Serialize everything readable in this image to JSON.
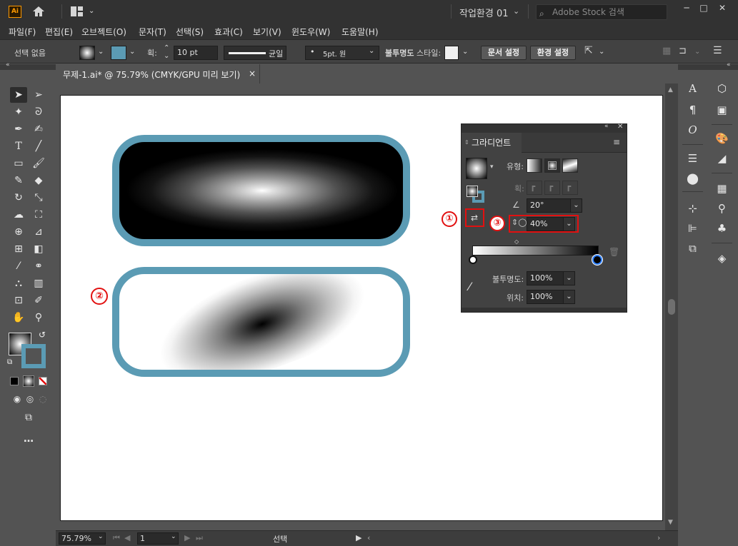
{
  "app": {
    "logo": "Ai",
    "workspace": "작업환경 01",
    "stock_search_placeholder": "Adobe Stock 검색"
  },
  "menu": [
    "파일(F)",
    "편집(E)",
    "오브젝트(O)",
    "문자(T)",
    "선택(S)",
    "효과(C)",
    "보기(V)",
    "윈도우(W)",
    "도움말(H)"
  ],
  "control": {
    "selection": "선택 없음",
    "stroke_label": "획:",
    "stroke_value": "10 pt",
    "profile": "균일",
    "brush": "5pt. 원",
    "opacity_label": "불투명도",
    "style_label": "스타일:",
    "doc_setup": "문서 설정",
    "preferences": "환경 설정"
  },
  "document": {
    "tab_title": "무제-1.ai* @ 75.79% (CMYK/GPU 미리 보기)",
    "close": "×"
  },
  "status": {
    "zoom": "75.79%",
    "page": "1",
    "tool": "선택"
  },
  "annotations": {
    "badge1": "①",
    "badge2": "②",
    "badge3": "③"
  },
  "gradient_panel": {
    "title": "그라디언트",
    "type_label": "유형:",
    "stroke_label": "획:",
    "angle": "20°",
    "aspect_ratio": "40%",
    "opacity_label": "불투명도:",
    "opacity_value": "100%",
    "location_label": "위치:",
    "location_value": "100%"
  },
  "colors": {
    "accent": "#5b9bb4",
    "highlight": "#e21010",
    "panel": "#424242",
    "ui_bg": "#535353"
  },
  "icons": [
    "home-icon",
    "layout-icon",
    "search-icon",
    "minimize-icon",
    "maximize-icon",
    "close-icon",
    "trash-icon",
    "eyedropper-icon",
    "panel-menu-icon"
  ]
}
